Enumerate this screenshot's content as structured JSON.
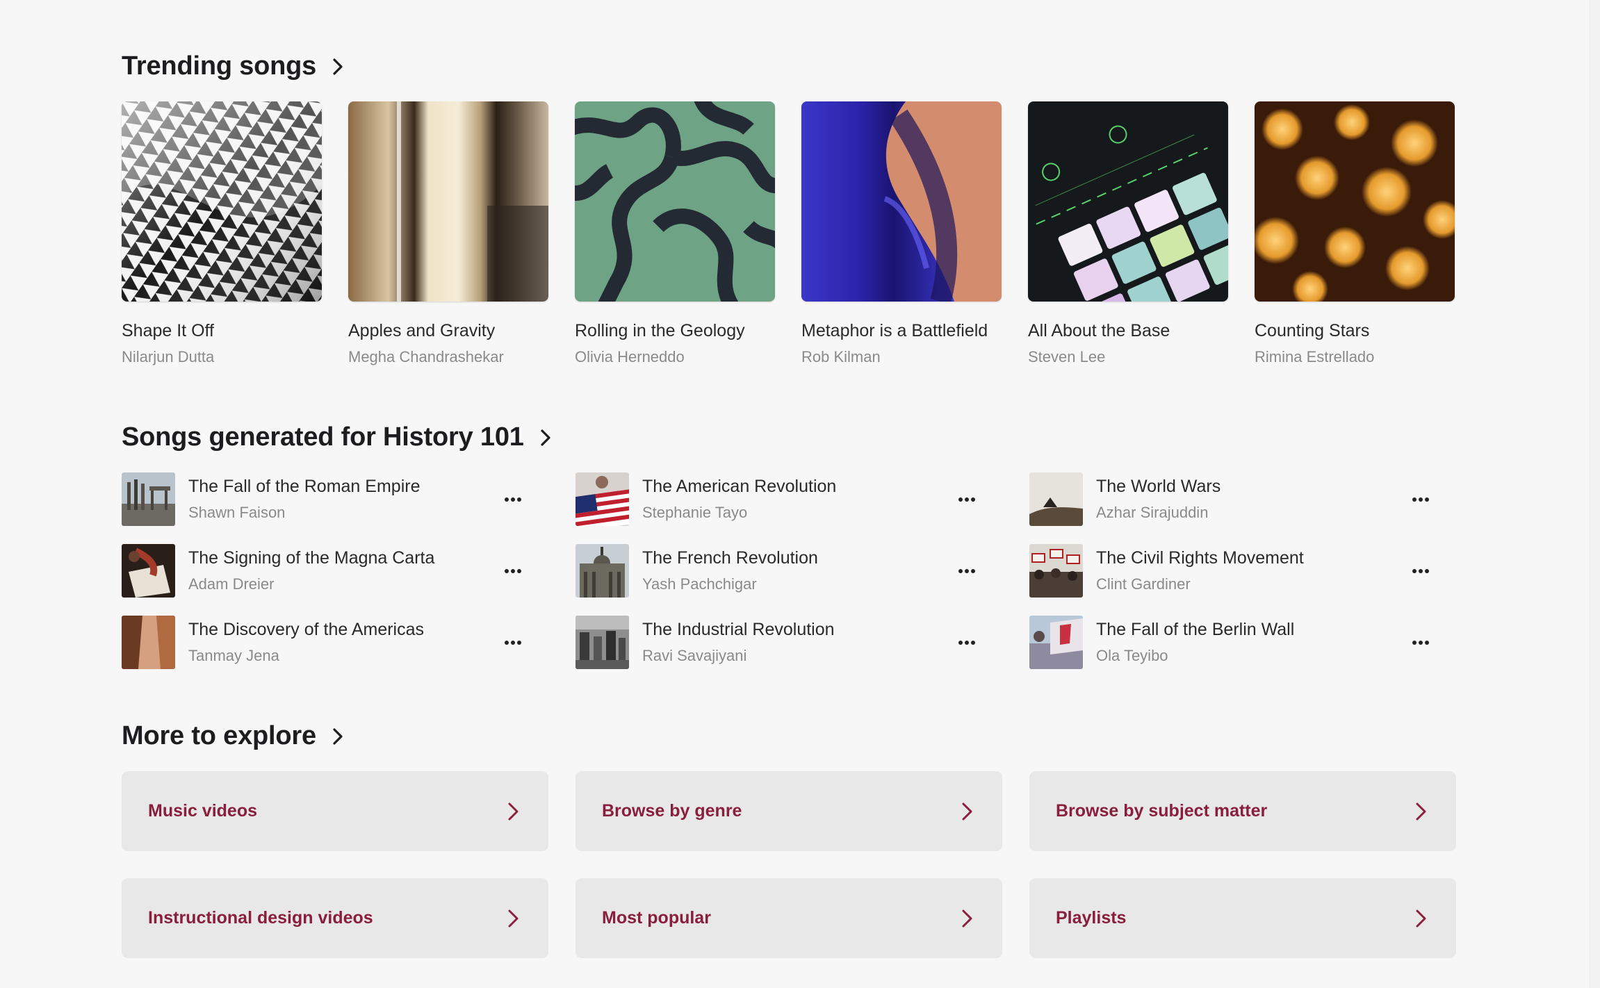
{
  "trending": {
    "title": "Trending songs",
    "songs": [
      {
        "title": "Shape It Off",
        "artist": "Nilarjun Dutta"
      },
      {
        "title": "Apples and Gravity",
        "artist": "Megha Chandrashekar"
      },
      {
        "title": "Rolling in the Geology",
        "artist": "Olivia Herneddo"
      },
      {
        "title": "Metaphor is a Battlefield",
        "artist": "Rob Kilman"
      },
      {
        "title": "All About the Base",
        "artist": "Steven Lee"
      },
      {
        "title": "Counting Stars",
        "artist": "Rimina Estrellado"
      }
    ]
  },
  "history": {
    "title": "Songs generated for History 101",
    "songs": [
      {
        "title": "The Fall of the Roman Empire",
        "artist": "Shawn Faison"
      },
      {
        "title": "The American Revolution",
        "artist": "Stephanie Tayo"
      },
      {
        "title": "The World Wars",
        "artist": "Azhar Sirajuddin"
      },
      {
        "title": "The Signing of the Magna Carta",
        "artist": "Adam Dreier"
      },
      {
        "title": "The French Revolution",
        "artist": "Yash Pachchigar"
      },
      {
        "title": "The Civil Rights Movement",
        "artist": "Clint Gardiner"
      },
      {
        "title": "The Discovery of the Americas",
        "artist": "Tanmay Jena"
      },
      {
        "title": "The Industrial Revolution",
        "artist": "Ravi Savajiyani"
      },
      {
        "title": "The Fall of the Berlin Wall",
        "artist": "Ola Teyibo"
      }
    ]
  },
  "explore": {
    "title": "More to explore",
    "tiles": [
      {
        "label": "Music videos"
      },
      {
        "label": "Browse by genre"
      },
      {
        "label": "Browse by subject matter"
      },
      {
        "label": "Instructional design videos"
      },
      {
        "label": "Most popular"
      },
      {
        "label": "Playlists"
      }
    ]
  },
  "colors": {
    "accent": "#8a1f3c",
    "tile_bg": "#e8e8e8",
    "page_bg": "#f7f7f7"
  },
  "icons": {
    "section_chevron": "chevron-right-icon",
    "row_more": "more-options-icon",
    "tile_chevron": "chevron-right-icon"
  }
}
